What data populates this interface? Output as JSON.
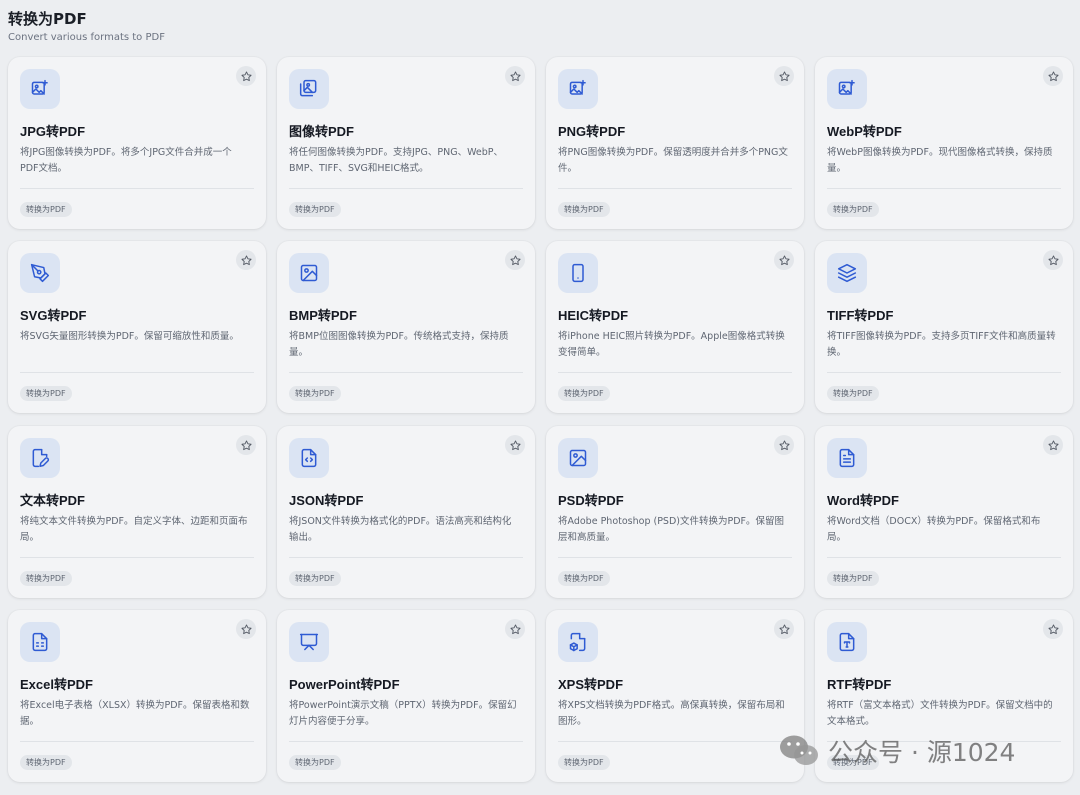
{
  "page": {
    "title": "转换为PDF",
    "subtitle": "Convert various formats to PDF"
  },
  "colors": {
    "background": "#eceef1",
    "card": "#f3f4f6",
    "icon_bg": "#dbe4f3",
    "icon_accent": "#2f5bd3"
  },
  "cards": [
    {
      "icon": "image-plus-icon",
      "title": "JPG转PDF",
      "desc": "将JPG图像转换为PDF。将多个JPG文件合并成一个PDF文档。",
      "tag": "转换为PDF"
    },
    {
      "icon": "images-icon",
      "title": "图像转PDF",
      "desc": "将任何图像转换为PDF。支持JPG、PNG、WebP、BMP、TIFF、SVG和HEIC格式。",
      "tag": "转换为PDF"
    },
    {
      "icon": "image-plus-icon",
      "title": "PNG转PDF",
      "desc": "将PNG图像转换为PDF。保留透明度并合并多个PNG文件。",
      "tag": "转换为PDF"
    },
    {
      "icon": "image-plus-icon",
      "title": "WebP转PDF",
      "desc": "将WebP图像转换为PDF。现代图像格式转换，保持质量。",
      "tag": "转换为PDF"
    },
    {
      "icon": "pen-tool-icon",
      "title": "SVG转PDF",
      "desc": "将SVG矢量图形转换为PDF。保留可缩放性和质量。",
      "tag": "转换为PDF"
    },
    {
      "icon": "image-icon",
      "title": "BMP转PDF",
      "desc": "将BMP位图图像转换为PDF。传统格式支持，保持质量。",
      "tag": "转换为PDF"
    },
    {
      "icon": "smartphone-icon",
      "title": "HEIC转PDF",
      "desc": "将iPhone HEIC照片转换为PDF。Apple图像格式转换变得简单。",
      "tag": "转换为PDF"
    },
    {
      "icon": "layers-icon",
      "title": "TIFF转PDF",
      "desc": "将TIFF图像转换为PDF。支持多页TIFF文件和高质量转换。",
      "tag": "转换为PDF"
    },
    {
      "icon": "file-pen-icon",
      "title": "文本转PDF",
      "desc": "将纯文本文件转换为PDF。自定义字体、边距和页面布局。",
      "tag": "转换为PDF"
    },
    {
      "icon": "file-code-icon",
      "title": "JSON转PDF",
      "desc": "将JSON文件转换为格式化的PDF。语法高亮和结构化输出。",
      "tag": "转换为PDF"
    },
    {
      "icon": "image-icon",
      "title": "PSD转PDF",
      "desc": "将Adobe Photoshop (PSD)文件转换为PDF。保留图层和高质量。",
      "tag": "转换为PDF"
    },
    {
      "icon": "file-text-icon",
      "title": "Word转PDF",
      "desc": "将Word文档（DOCX）转换为PDF。保留格式和布局。",
      "tag": "转换为PDF"
    },
    {
      "icon": "file-spreadsheet-icon",
      "title": "Excel转PDF",
      "desc": "将Excel电子表格（XLSX）转换为PDF。保留表格和数据。",
      "tag": "转换为PDF"
    },
    {
      "icon": "presentation-icon",
      "title": "PowerPoint转PDF",
      "desc": "将PowerPoint演示文稿（PPTX）转换为PDF。保留幻灯片内容便于分享。",
      "tag": "转换为PDF"
    },
    {
      "icon": "file-box-icon",
      "title": "XPS转PDF",
      "desc": "将XPS文档转换为PDF格式。高保真转换，保留布局和图形。",
      "tag": "转换为PDF"
    },
    {
      "icon": "file-type-icon",
      "title": "RTF转PDF",
      "desc": "将RTF（富文本格式）文件转换为PDF。保留文档中的文本格式。",
      "tag": "转换为PDF"
    }
  ],
  "watermark": {
    "text": "公众号 · 源1024",
    "icon": "wechat-icon"
  }
}
